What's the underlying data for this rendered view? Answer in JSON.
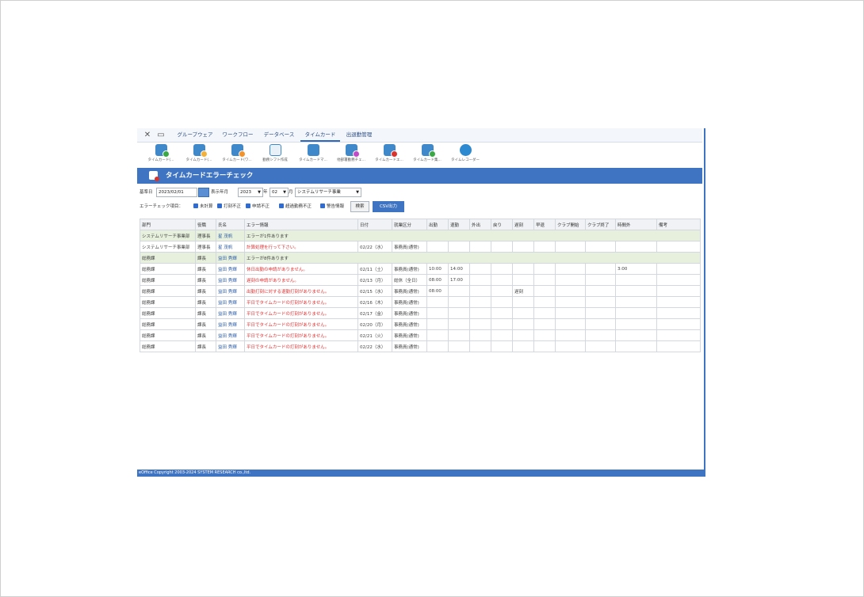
{
  "menubar": {
    "controls": {
      "close": "✕",
      "window": "▭"
    },
    "tabs": [
      {
        "label": "グループウェア"
      },
      {
        "label": "ワークフロー"
      },
      {
        "label": "データベース"
      },
      {
        "label": "タイムカード"
      },
      {
        "label": "出退勤管理"
      }
    ],
    "active_tab": "タイムカード"
  },
  "toolbar": {
    "items": [
      {
        "label": "タイムカード(...",
        "icon": "timecard-icon",
        "badge_color": "#3aa845"
      },
      {
        "label": "タイムカード(...",
        "icon": "timecard-icon",
        "badge_color": "#f2b13a"
      },
      {
        "label": "タイムカード(ワ...",
        "icon": "timecard-icon",
        "badge_color": "#f2922a"
      },
      {
        "label": "勤務シフト作成",
        "icon": "calendar-icon",
        "badge_color": ""
      },
      {
        "label": "タイムカードマ...",
        "icon": "timecard-icon",
        "badge_color": ""
      },
      {
        "label": "他部署勤務チェ...",
        "icon": "timecard-icon",
        "badge_color": "#c04bc8"
      },
      {
        "label": "タイムカードエ...",
        "icon": "timecard-icon",
        "badge_color": "#d9342b"
      },
      {
        "label": "タイムカード集...",
        "icon": "timecard-icon",
        "badge_color": "#3aa845"
      },
      {
        "label": "タイムレコーダー",
        "icon": "clock-icon",
        "badge_color": ""
      }
    ]
  },
  "page_title": "タイムカードエラーチェック",
  "filters": {
    "base_date_label": "基準日",
    "base_date": "2023/02/01",
    "display_period_label": "表示年月",
    "year": "2023",
    "year_suffix": "年",
    "month": "02",
    "month_suffix": "月",
    "department": "システムリサーチ事業",
    "error_check_label": "エラーチェック項目：",
    "checks": [
      {
        "label": "未計算",
        "checked": true
      },
      {
        "label": "打刻不正",
        "checked": true
      },
      {
        "label": "申請不正",
        "checked": true
      },
      {
        "label": "超過勤務不正",
        "checked": true
      },
      {
        "label": "警告情報",
        "checked": true
      }
    ],
    "search_button": "検索",
    "csv_button": "CSV出力"
  },
  "table": {
    "columns": [
      "部門",
      "役職",
      "氏名",
      "エラー情報",
      "日付",
      "就業区分",
      "出勤",
      "退勤",
      "外出",
      "戻り",
      "遅刻",
      "早退",
      "クラブ開始",
      "クラブ終了",
      "時間外",
      "備考"
    ],
    "rows": [
      {
        "group": true,
        "dept": "システムリサーチ事業部",
        "role": "理事長",
        "name": "星 茂帆",
        "error": "エラーが1件あります"
      },
      {
        "group": false,
        "dept": "システムリサーチ事業部",
        "role": "理事長",
        "name": "星 茂帆",
        "error": "計算処理を行って下さい。",
        "date": "02/22（水）",
        "type": "事務員(通常)",
        "in": "",
        "out": "",
        "exit": "",
        "back": "",
        "late": "",
        "early": "",
        "club_start": "",
        "club_end": "",
        "overtime": "",
        "note": ""
      },
      {
        "group": true,
        "dept": "総務課",
        "role": "課長",
        "name": "益田 秀輝",
        "error": "エラーが8件あります"
      },
      {
        "group": false,
        "dept": "総務課",
        "role": "課長",
        "name": "益田 秀輝",
        "error": "休日出勤の申請がありません。",
        "date": "02/11（土）",
        "type": "事務員(通常)",
        "in": "10:00",
        "out": "14:00",
        "exit": "",
        "back": "",
        "late": "",
        "early": "",
        "club_start": "",
        "club_end": "",
        "overtime": "3:00",
        "note": ""
      },
      {
        "group": false,
        "dept": "総務課",
        "role": "課長",
        "name": "益田 秀輝",
        "error": "遅刻の申請がありません。",
        "date": "02/13（月）",
        "type": "総休（全日）",
        "in": "08:00",
        "out": "17:00",
        "exit": "",
        "back": "",
        "late": "",
        "early": "",
        "club_start": "",
        "club_end": "",
        "overtime": "",
        "note": ""
      },
      {
        "group": false,
        "dept": "総務課",
        "role": "課長",
        "name": "益田 秀輝",
        "error": "出勤打刻に対する退勤打刻がありません。",
        "date": "02/15（水）",
        "type": "事務員(通常)",
        "in": "08:00",
        "out": "",
        "exit": "",
        "back": "",
        "late": "遅刻",
        "early": "",
        "club_start": "",
        "club_end": "",
        "overtime": "",
        "note": ""
      },
      {
        "group": false,
        "dept": "総務課",
        "role": "課長",
        "name": "益田 秀輝",
        "error": "平日でタイムカードの打刻がありません。",
        "date": "02/16（木）",
        "type": "事務員(通常)",
        "in": "",
        "out": "",
        "exit": "",
        "back": "",
        "late": "",
        "early": "",
        "club_start": "",
        "club_end": "",
        "overtime": "",
        "note": ""
      },
      {
        "group": false,
        "dept": "総務課",
        "role": "課長",
        "name": "益田 秀輝",
        "error": "平日でタイムカードの打刻がありません。",
        "date": "02/17（金）",
        "type": "事務員(通常)",
        "in": "",
        "out": "",
        "exit": "",
        "back": "",
        "late": "",
        "early": "",
        "club_start": "",
        "club_end": "",
        "overtime": "",
        "note": ""
      },
      {
        "group": false,
        "dept": "総務課",
        "role": "課長",
        "name": "益田 秀輝",
        "error": "平日でタイムカードの打刻がありません。",
        "date": "02/20（月）",
        "type": "事務員(通常)",
        "in": "",
        "out": "",
        "exit": "",
        "back": "",
        "late": "",
        "early": "",
        "club_start": "",
        "club_end": "",
        "overtime": "",
        "note": ""
      },
      {
        "group": false,
        "dept": "総務課",
        "role": "課長",
        "name": "益田 秀輝",
        "error": "平日でタイムカードの打刻がありません。",
        "date": "02/21（火）",
        "type": "事務員(通常)",
        "in": "",
        "out": "",
        "exit": "",
        "back": "",
        "late": "",
        "early": "",
        "club_start": "",
        "club_end": "",
        "overtime": "",
        "note": ""
      },
      {
        "group": false,
        "dept": "総務課",
        "role": "課長",
        "name": "益田 秀輝",
        "error": "平日でタイムカードの打刻がありません。",
        "date": "02/22（水）",
        "type": "事務員(通常)",
        "in": "",
        "out": "",
        "exit": "",
        "back": "",
        "late": "",
        "early": "",
        "club_start": "",
        "club_end": "",
        "overtime": "",
        "note": ""
      }
    ]
  },
  "footer": "eOffice Copyright 2003-2024 SYSTEM RESEARCH co.,ltd.",
  "colors": {
    "accent": "#3f74c2",
    "error_text": "#e03030",
    "group_row": "#e7f0dc"
  }
}
